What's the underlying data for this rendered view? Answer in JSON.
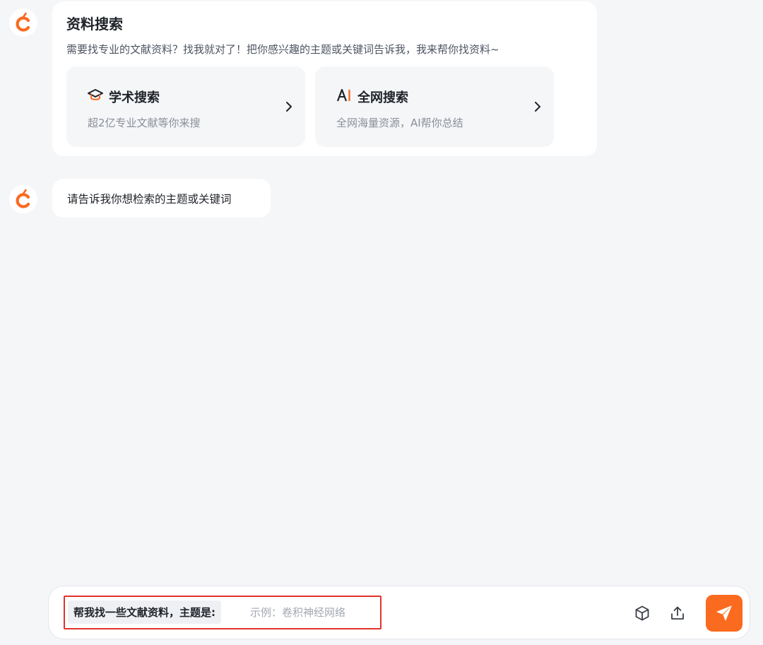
{
  "colors": {
    "accent": "#fa6a1f",
    "background": "#f5f6f8",
    "highlight_border": "#e0332b"
  },
  "messages": [
    {
      "avatar_icon": "orange-c-logo",
      "card": {
        "title": "资料搜索",
        "description": "需要找专业的文献资料？找我就对了！把你感兴趣的主题或关键词告诉我，我来帮你找资料~",
        "options": [
          {
            "icon": "graduation-cap-icon",
            "title": "学术搜索",
            "subtitle": "超2亿专业文献等你来搜"
          },
          {
            "icon": "ai-icon",
            "title": "全网搜索",
            "subtitle": "全网海量资源，AI帮你总结"
          }
        ]
      }
    },
    {
      "avatar_icon": "orange-c-logo",
      "text": "请告诉我你想检索的主题或关键词"
    }
  ],
  "composer": {
    "prompt_prefix": "帮我找一些文献资料，主题是:",
    "placeholder": "示例：卷积神经网络",
    "value": "",
    "tools": [
      "cube-icon",
      "upload-icon"
    ],
    "send_icon": "send-icon"
  }
}
